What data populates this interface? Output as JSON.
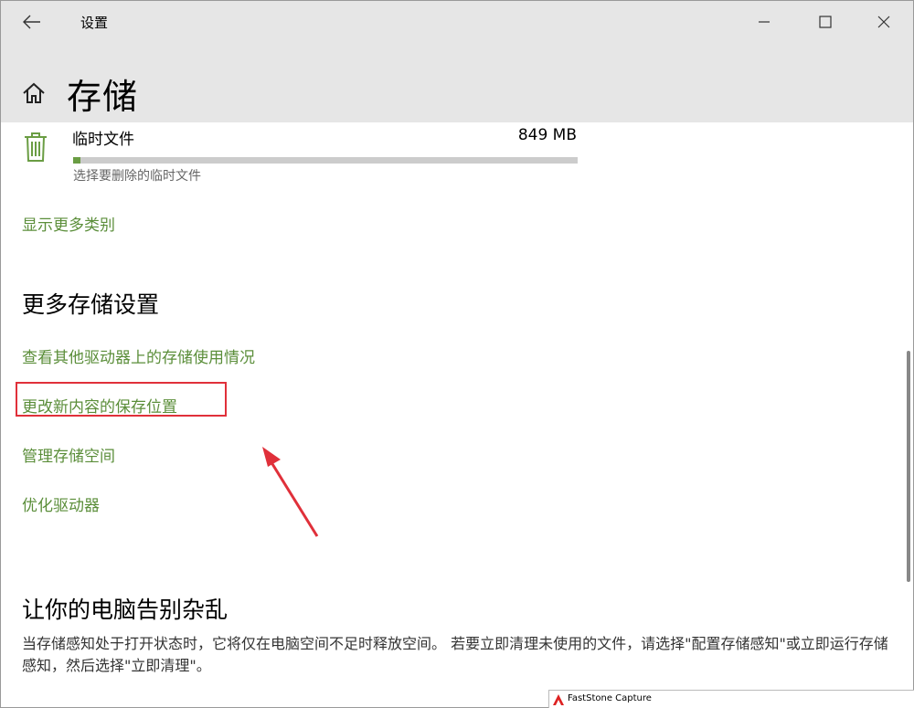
{
  "window": {
    "app_title": "设置",
    "controls": {
      "minimize": "minimize",
      "maximize": "maximize",
      "close": "close"
    }
  },
  "page": {
    "title": "存储"
  },
  "temp_files": {
    "name": "临时文件",
    "size": "849 MB",
    "usage_fraction": 0.015,
    "description": "选择要删除的临时文件"
  },
  "links": {
    "show_more": "显示更多类别"
  },
  "more_settings": {
    "heading": "更多存储设置",
    "items": [
      "查看其他驱动器上的存储使用情况",
      "更改新内容的保存位置",
      "管理存储空间",
      "优化驱动器"
    ]
  },
  "declutter": {
    "heading": "让你的电脑告别杂乱",
    "description": "当存储感知处于打开状态时，它将仅在电脑空间不足时释放空间。 若要立即清理未使用的文件，请选择\"配置存储感知\"或立即运行存储感知，然后选择\"立即清理\"。"
  },
  "taskbar_overlay": {
    "label": "FastStone Capture"
  },
  "colors": {
    "accent": "#5b8e3a",
    "highlight": "#e0303a",
    "bar_fill": "#6a9d43"
  },
  "icons": [
    "back-arrow-icon",
    "home-icon",
    "trash-icon",
    "minimize-icon",
    "maximize-icon",
    "close-icon",
    "annotation-arrow-icon"
  ]
}
